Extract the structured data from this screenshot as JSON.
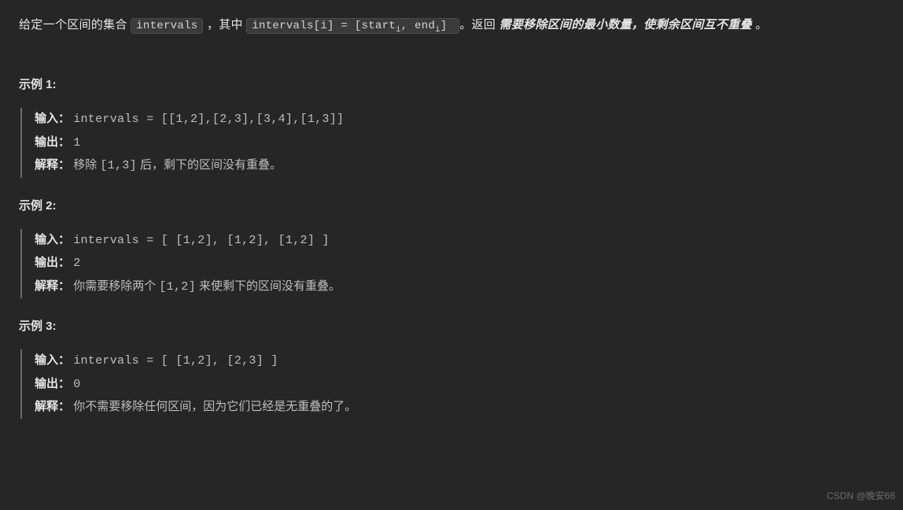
{
  "problem": {
    "pre1": "给定一个区间的集合 ",
    "code1": "intervals",
    "mid1": " ，其中 ",
    "code2_prefix": "intervals[i] = [start",
    "code2_sub1": "i",
    "code2_mid": ", end",
    "code2_sub2": "i",
    "code2_suffix": "]",
    "post1": " 。返回 ",
    "emph": "需要移除区间的最小数量，使剩余区间互不重叠 ",
    "post2": "。"
  },
  "examples": [
    {
      "heading": "示例 1:",
      "input_label": "输入：",
      "input_value": "intervals = [[1,2],[2,3],[3,4],[1,3]]",
      "output_label": "输出：",
      "output_value": "1",
      "explain_label": "解释：",
      "explain_pre": "移除 ",
      "explain_code": "[1,3]",
      "explain_post": " 后，剩下的区间没有重叠。"
    },
    {
      "heading": "示例 2:",
      "input_label": "输入：",
      "input_value": "intervals = [ [1,2], [1,2], [1,2] ]",
      "output_label": "输出：",
      "output_value": "2",
      "explain_label": "解释：",
      "explain_pre": "你需要移除两个 ",
      "explain_code": "[1,2]",
      "explain_post": " 来使剩下的区间没有重叠。"
    },
    {
      "heading": "示例 3:",
      "input_label": "输入：",
      "input_value": "intervals = [ [1,2], [2,3] ]",
      "output_label": "输出：",
      "output_value": "0",
      "explain_label": "解释：",
      "explain_pre": "你不需要移除任何区间，因为它们已经是无重叠的了。",
      "explain_code": "",
      "explain_post": ""
    }
  ],
  "watermark": "CSDN @晚安66"
}
